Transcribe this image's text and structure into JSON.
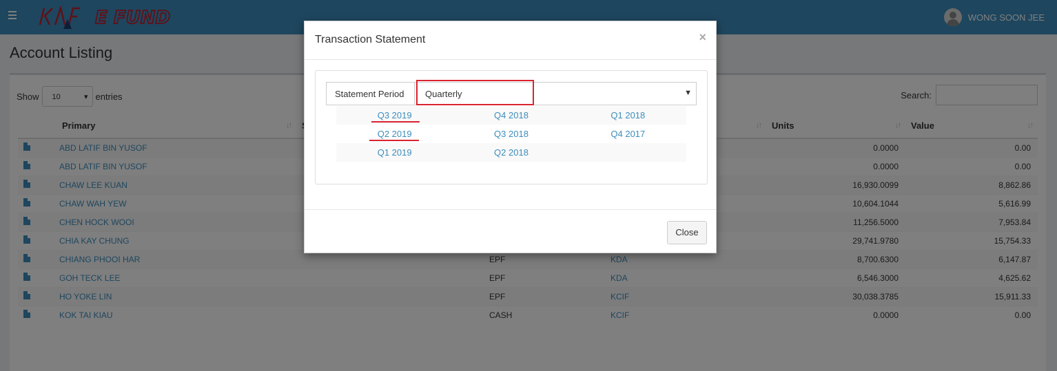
{
  "header": {
    "user_name": "WONG SOON JEE",
    "brand_color": "#3c8dbc"
  },
  "page": {
    "title": "Account Listing"
  },
  "table_controls": {
    "show_label": "Show",
    "entries_value": "10",
    "entries_label": "entries",
    "search_label": "Search:"
  },
  "table": {
    "columns": [
      "Primary",
      "S",
      "Units",
      "Value"
    ],
    "rows": [
      {
        "name": "ABD LATIF BIN YUSOF",
        "type": "",
        "fund": "",
        "units": "0.0000",
        "value": "0.00"
      },
      {
        "name": "ABD LATIF BIN YUSOF",
        "type": "",
        "fund": "",
        "units": "0.0000",
        "value": "0.00"
      },
      {
        "name": "CHAW LEE KUAN",
        "type": "",
        "fund": "",
        "units": "16,930.0099",
        "value": "8,862.86"
      },
      {
        "name": "CHAW WAH YEW",
        "type": "",
        "fund": "",
        "units": "10,604.1044",
        "value": "5,616.99"
      },
      {
        "name": "CHEN HOCK WOOI",
        "type": "",
        "fund": "",
        "units": "11,256.5000",
        "value": "7,953.84"
      },
      {
        "name": "CHIA KAY CHUNG",
        "type": "",
        "fund": "",
        "units": "29,741.9780",
        "value": "15,754.33"
      },
      {
        "name": "CHIANG PHOOI HAR",
        "type": "EPF",
        "fund": "KDA",
        "units": "8,700.6300",
        "value": "6,147.87"
      },
      {
        "name": "GOH TECK LEE",
        "type": "EPF",
        "fund": "KDA",
        "units": "6,546.3000",
        "value": "4,625.62"
      },
      {
        "name": "HO YOKE LIN",
        "type": "EPF",
        "fund": "KCIF",
        "units": "30,038.3785",
        "value": "15,911.33"
      },
      {
        "name": "KOK TAI KIAU",
        "type": "CASH",
        "fund": "KCIF",
        "units": "0.0000",
        "value": "0.00"
      }
    ]
  },
  "modal": {
    "title": "Transaction Statement",
    "close_symbol": "×",
    "period_label": "Statement Period",
    "period_value": "Quarterly",
    "periods": [
      [
        "Q3 2019",
        "Q4 2018",
        "Q1 2018"
      ],
      [
        "Q2 2019",
        "Q3 2018",
        "Q4 2017"
      ],
      [
        "Q1 2019",
        "Q2 2018",
        ""
      ]
    ],
    "close_button": "Close",
    "highlight_color": "#d9232e"
  }
}
